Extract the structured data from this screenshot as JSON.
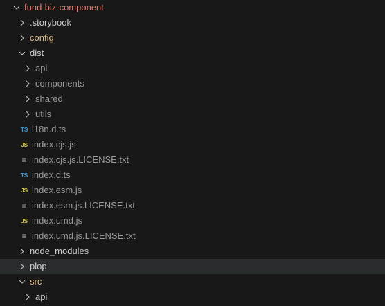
{
  "colors": {
    "root": "#e8746a",
    "modified": "#e2c08d",
    "normal": "#cccccc",
    "ignored": "#9a9a9a",
    "ts": "#3b9bd6",
    "js": "#d4c93a",
    "txt": "#bbbbbb"
  },
  "items": [
    {
      "label": "fund-biz-component",
      "depth": 0,
      "type": "folder",
      "open": true,
      "color": "root"
    },
    {
      "label": ".storybook",
      "depth": 1,
      "type": "folder",
      "open": false,
      "color": "normal"
    },
    {
      "label": "config",
      "depth": 1,
      "type": "folder",
      "open": false,
      "color": "modified"
    },
    {
      "label": "dist",
      "depth": 1,
      "type": "folder",
      "open": true,
      "color": "normal"
    },
    {
      "label": "api",
      "depth": 2,
      "type": "folder",
      "open": false,
      "color": "ignored"
    },
    {
      "label": "components",
      "depth": 2,
      "type": "folder",
      "open": false,
      "color": "ignored"
    },
    {
      "label": "shared",
      "depth": 2,
      "type": "folder",
      "open": false,
      "color": "ignored"
    },
    {
      "label": "utils",
      "depth": 2,
      "type": "folder",
      "open": false,
      "color": "ignored"
    },
    {
      "label": "i18n.d.ts",
      "depth": 2,
      "type": "file",
      "icon": "ts",
      "icon_text": "TS",
      "color": "ignored"
    },
    {
      "label": "index.cjs.js",
      "depth": 2,
      "type": "file",
      "icon": "js",
      "icon_text": "JS",
      "color": "ignored"
    },
    {
      "label": "index.cjs.js.LICENSE.txt",
      "depth": 2,
      "type": "file",
      "icon": "txt",
      "icon_text": "≡",
      "color": "ignored"
    },
    {
      "label": "index.d.ts",
      "depth": 2,
      "type": "file",
      "icon": "ts",
      "icon_text": "TS",
      "color": "ignored"
    },
    {
      "label": "index.esm.js",
      "depth": 2,
      "type": "file",
      "icon": "js",
      "icon_text": "JS",
      "color": "ignored"
    },
    {
      "label": "index.esm.js.LICENSE.txt",
      "depth": 2,
      "type": "file",
      "icon": "txt",
      "icon_text": "≡",
      "color": "ignored"
    },
    {
      "label": "index.umd.js",
      "depth": 2,
      "type": "file",
      "icon": "js",
      "icon_text": "JS",
      "color": "ignored"
    },
    {
      "label": "index.umd.js.LICENSE.txt",
      "depth": 2,
      "type": "file",
      "icon": "txt",
      "icon_text": "≡",
      "color": "ignored"
    },
    {
      "label": "node_modules",
      "depth": 1,
      "type": "folder",
      "open": false,
      "color": "normal"
    },
    {
      "label": "plop",
      "depth": 1,
      "type": "folder",
      "open": false,
      "color": "normal",
      "hover": true
    },
    {
      "label": "src",
      "depth": 1,
      "type": "folder",
      "open": true,
      "color": "modified"
    },
    {
      "label": "api",
      "depth": 2,
      "type": "folder",
      "open": false,
      "color": "normal"
    }
  ]
}
